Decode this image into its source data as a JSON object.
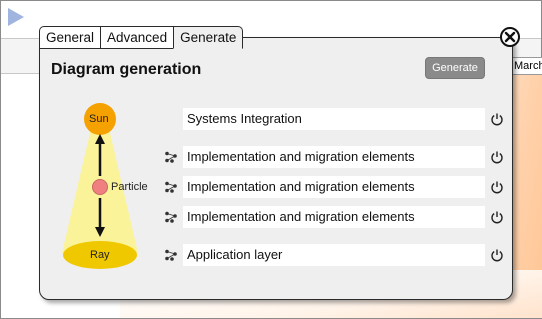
{
  "background": {
    "month_label": "March"
  },
  "tabs": [
    {
      "label": "General"
    },
    {
      "label": "Advanced"
    },
    {
      "label": "Generate"
    }
  ],
  "panel": {
    "title": "Diagram generation",
    "generate_button": "Generate"
  },
  "diagram": {
    "top_label": "Sun",
    "middle_label": "Particle",
    "bottom_label": "Ray"
  },
  "rows": [
    {
      "label": "Systems Integration",
      "icon": "none"
    },
    {
      "label": "Implementation and migration elements",
      "icon": "node-graph-icon"
    },
    {
      "label": "Implementation and migration elements",
      "icon": "node-graph-icon"
    },
    {
      "label": "Implementation and migration elements",
      "icon": "node-graph-icon"
    },
    {
      "label": "Application layer",
      "icon": "node-graph-icon"
    }
  ],
  "colors": {
    "sun": "#f5a100",
    "ray": "#f0c800",
    "beam": "#fbf39a",
    "particle": "#f08080",
    "button": "#8a8a8a"
  }
}
